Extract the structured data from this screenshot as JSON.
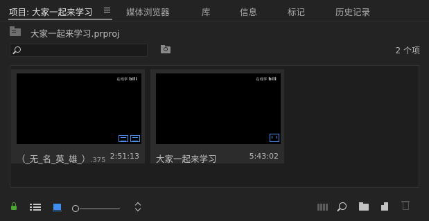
{
  "tabs": [
    {
      "label": "项目: 大家一起来学习",
      "active": true
    },
    {
      "label": "媒体浏览器",
      "active": false
    },
    {
      "label": "库",
      "active": false
    },
    {
      "label": "信息",
      "active": false
    },
    {
      "label": "标记",
      "active": false
    },
    {
      "label": "历史记录",
      "active": false
    }
  ],
  "project": {
    "file_name": "大家一起来学习.prproj",
    "item_count": "2 个项"
  },
  "search": {
    "placeholder": "",
    "value": ""
  },
  "items": [
    {
      "name": "（_无_名_英_雄_）",
      "ext": ".375",
      "duration": "2:51:13",
      "watermark_small": "在线学",
      "watermark_big": "bili"
    },
    {
      "name": "大家一起来学习",
      "ext": "",
      "duration": "5:43:02",
      "watermark_small": "在线学",
      "watermark_big": "bili"
    }
  ],
  "colors": {
    "accent_blue": "#3d8ef0",
    "lock_green": "#4aa832",
    "panel_bg": "#232323"
  },
  "icons": [
    "folder-up-icon",
    "search-icon",
    "bin-search-icon",
    "lock-icon",
    "list-view-icon",
    "icon-view-icon",
    "zoom-slider",
    "sort-icon",
    "automate-icon",
    "find-icon",
    "new-bin-icon",
    "new-item-icon",
    "trash-icon"
  ]
}
